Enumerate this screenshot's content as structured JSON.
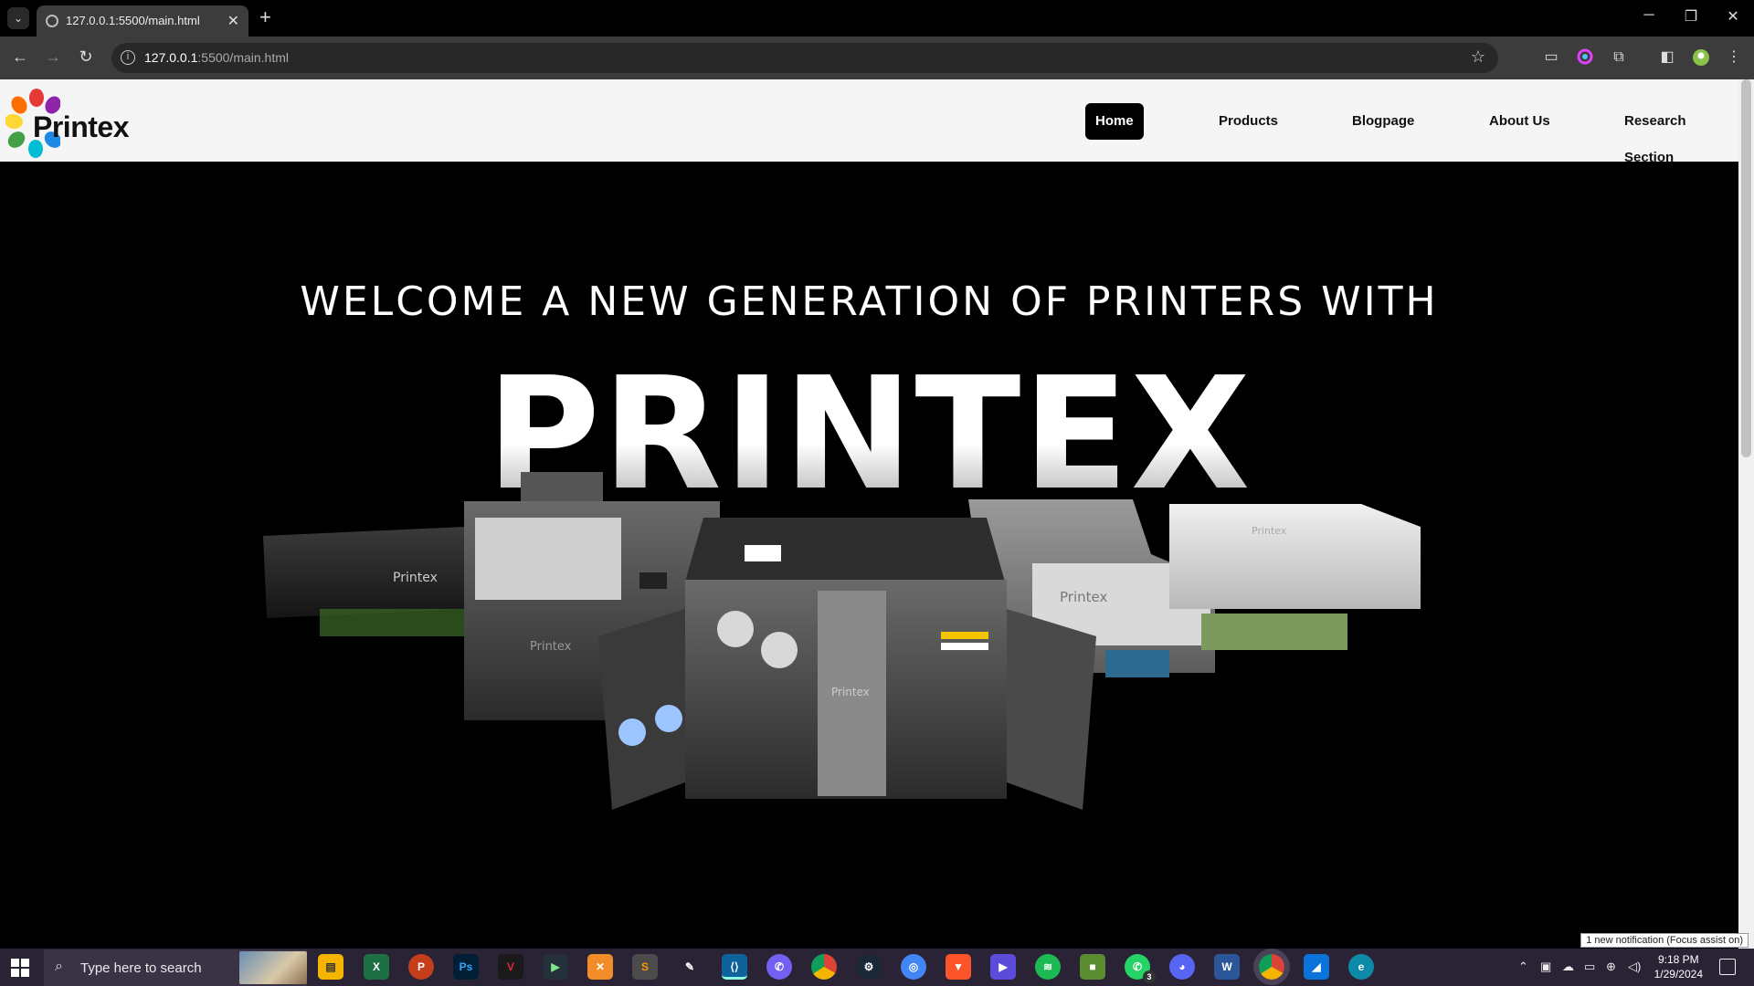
{
  "browser": {
    "tab_title": "127.0.0.1:5500/main.html",
    "url_host": "127.0.0.1",
    "url_rest": ":5500/main.html"
  },
  "site": {
    "logo_text": "Printex",
    "nav": [
      {
        "label": "Home",
        "active": true
      },
      {
        "label": "Products",
        "active": false
      },
      {
        "label": "Blogpage",
        "active": false
      },
      {
        "label": "About Us",
        "active": false
      },
      {
        "label": "Research Section",
        "active": false
      }
    ],
    "hero": {
      "subtitle": "WELCOME A NEW GENERATION OF PRINTERS WITH",
      "title": "PRINTEX"
    },
    "printer_brand": "Printex"
  },
  "taskbar": {
    "search_placeholder": "Type here to search",
    "time": "9:18 PM",
    "date": "1/29/2024",
    "whatsapp_badge": "3",
    "notification_toast": "1 new notification (Focus assist on)"
  },
  "colors": {
    "navbar_bg": "#f5f5f5",
    "page_bg": "#000000",
    "active_link_bg": "#000000",
    "taskbar_bg": "#2a2336"
  }
}
